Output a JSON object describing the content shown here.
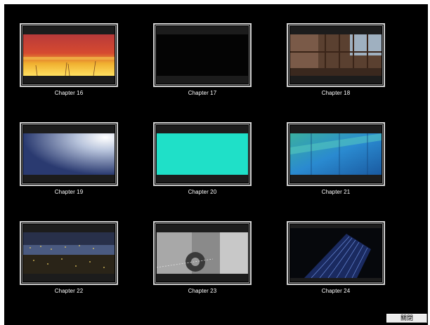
{
  "chapters": [
    {
      "label": "Chapter 16",
      "scene": "sunset-reeds"
    },
    {
      "label": "Chapter 17",
      "scene": "black-frame"
    },
    {
      "label": "Chapter 18",
      "scene": "industrial-interior"
    },
    {
      "label": "Chapter 19",
      "scene": "blue-sky-light"
    },
    {
      "label": "Chapter 20",
      "scene": "cyan-frame"
    },
    {
      "label": "Chapter 21",
      "scene": "blue-glass-building"
    },
    {
      "label": "Chapter 22",
      "scene": "night-harbor"
    },
    {
      "label": "Chapter 23",
      "scene": "grey-machinery"
    },
    {
      "label": "Chapter 24",
      "scene": "skyscraper-night"
    }
  ],
  "footer": {
    "close_label": "關閉"
  },
  "colors": {
    "background": "#000000",
    "thumb_border": "#d0d0d0",
    "label_text": "#ffffff",
    "cyan_frame": "#1fe0c8"
  }
}
